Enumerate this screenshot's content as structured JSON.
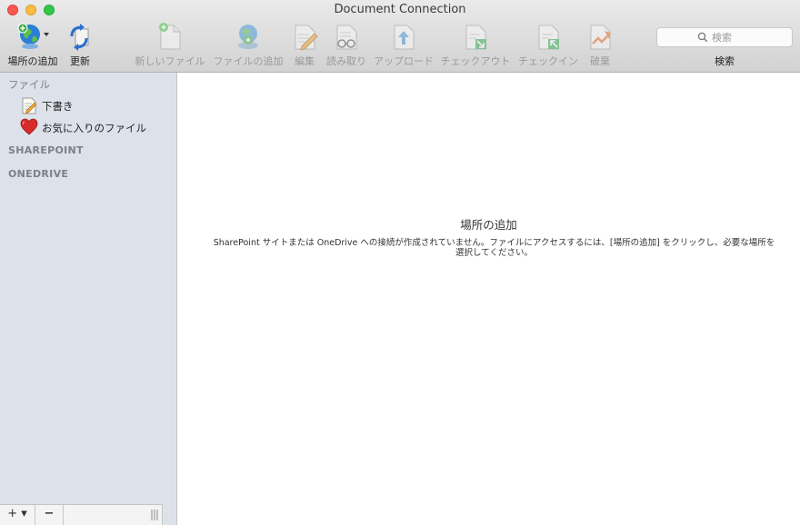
{
  "window": {
    "title": "Document Connection"
  },
  "toolbar": {
    "add_location": "場所の追加",
    "refresh": "更新",
    "new_file": "新しいファイル",
    "add_file": "ファイルの追加",
    "edit": "編集",
    "read": "読み取り",
    "upload": "アップロード",
    "checkout": "チェックアウト",
    "checkin": "チェックイン",
    "discard": "破棄",
    "search_placeholder": "検索",
    "search_label": "検索"
  },
  "sidebar": {
    "files_header": "ファイル",
    "items": [
      {
        "label": "下書き",
        "icon": "drafts-icon"
      },
      {
        "label": "お気に入りのファイル",
        "icon": "heart-icon"
      }
    ],
    "sharepoint_header": "SHAREPOINT",
    "onedrive_header": "ONEDRIVE",
    "add_button": "+ ▾",
    "remove_button": "−"
  },
  "content": {
    "empty_title": "場所の追加",
    "empty_message": "SharePoint サイトまたは OneDrive への接続が作成されていません。ファイルにアクセスするには、[場所の追加] をクリックし、必要な場所を選択してください。"
  },
  "colors": {
    "sidebar_bg": "#dde2ea",
    "close": "#fc5753",
    "minimize": "#fdbc40",
    "maximize": "#33c748"
  }
}
